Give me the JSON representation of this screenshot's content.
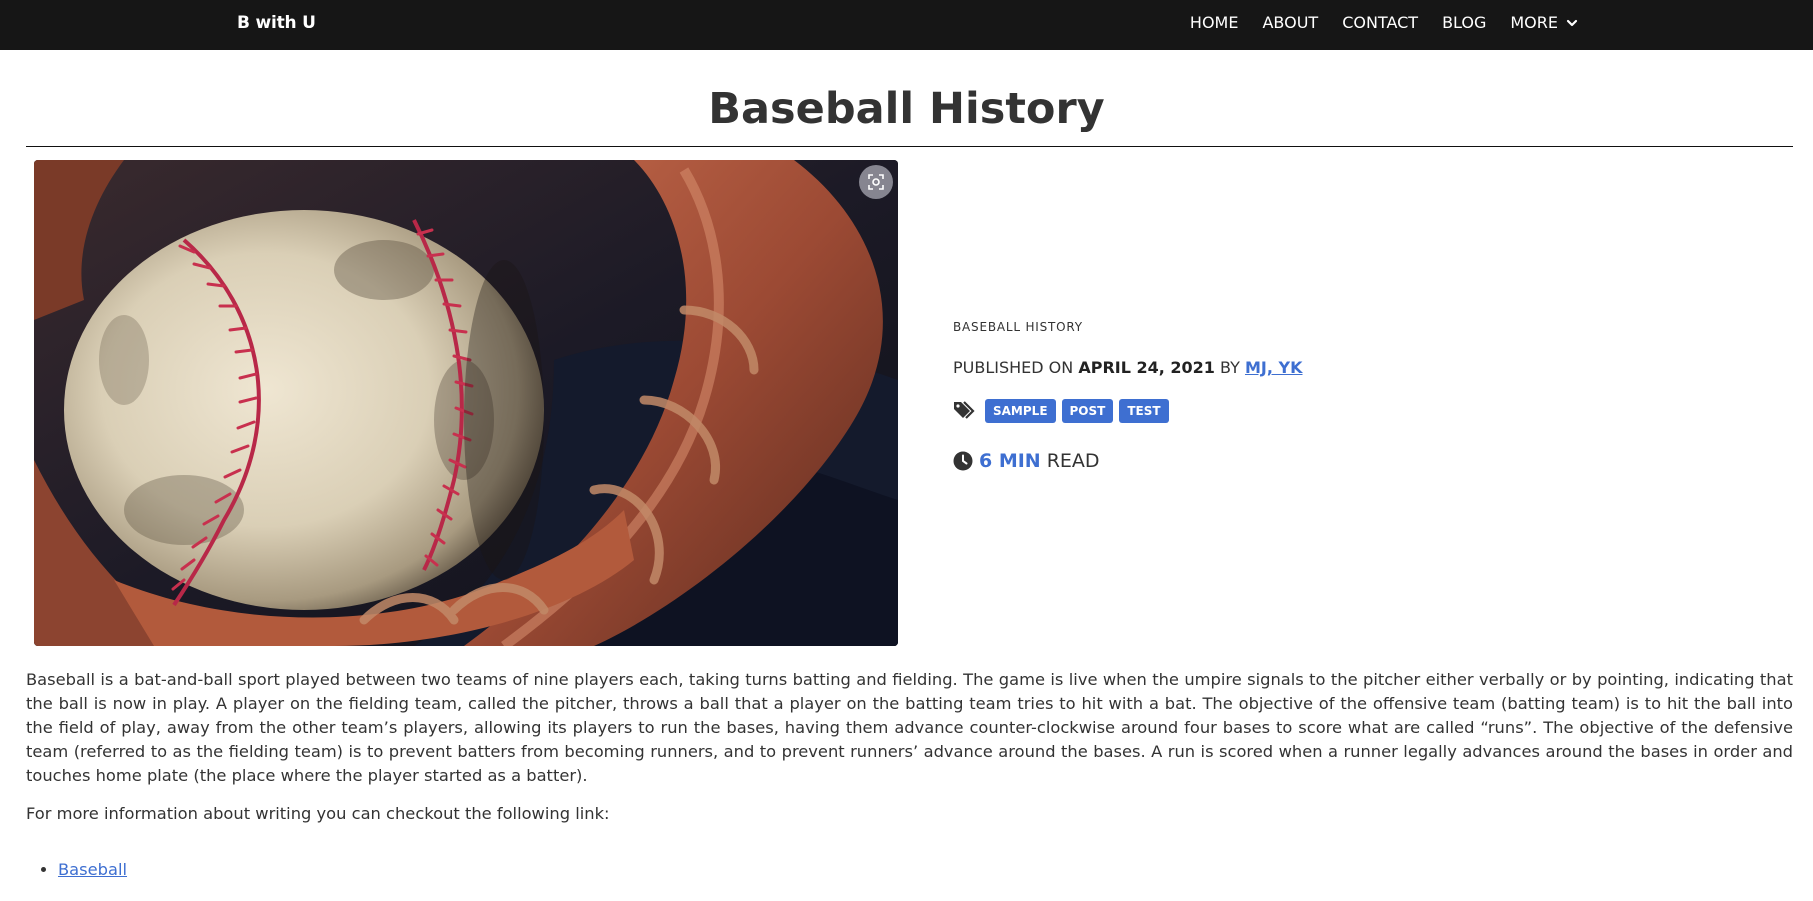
{
  "nav": {
    "brand": "B with U",
    "links": [
      "HOME",
      "ABOUT",
      "CONTACT",
      "BLOG",
      "MORE"
    ]
  },
  "post": {
    "title": "Baseball History",
    "category": "BASEBALL HISTORY",
    "published_prefix": "PUBLISHED ON",
    "date": "APRIL 24, 2021",
    "by": "BY",
    "author": "MJ, YK",
    "tags": [
      "SAMPLE",
      "POST",
      "TEST"
    ],
    "read_minutes": "6 MIN",
    "read_label": "READ",
    "body": "Baseball is a bat-and-ball sport played between two teams of nine players each, taking turns batting and fielding. The game is live when the umpire signals to the pitcher either verbally or by pointing, indicating that the ball is now in play. A player on the fielding team, called the pitcher, throws a ball that a player on the batting team tries to hit with a bat. The objective of the offensive team (batting team) is to hit the ball into the field of play, away from the other team’s players, allowing its players to run the bases, having them advance counter-clockwise around four bases to score what are called “runs”. The objective of the defensive team (referred to as the fielding team) is to prevent batters from becoming runners, and to prevent runners’ advance around the bases. A run is scored when a runner legally advances around the bases in order and touches home plate (the place where the player started as a batter).",
    "more_info": "For more information about writing you can checkout the following link:",
    "links": [
      "Baseball"
    ]
  },
  "icons": {
    "tag": "tags-icon",
    "clock": "clock-icon",
    "zoom": "zoom-icon",
    "more": "chevron-down-icon"
  },
  "colors": {
    "navbar": "#161616",
    "accent": "#3e6fd1",
    "text": "#333333"
  }
}
